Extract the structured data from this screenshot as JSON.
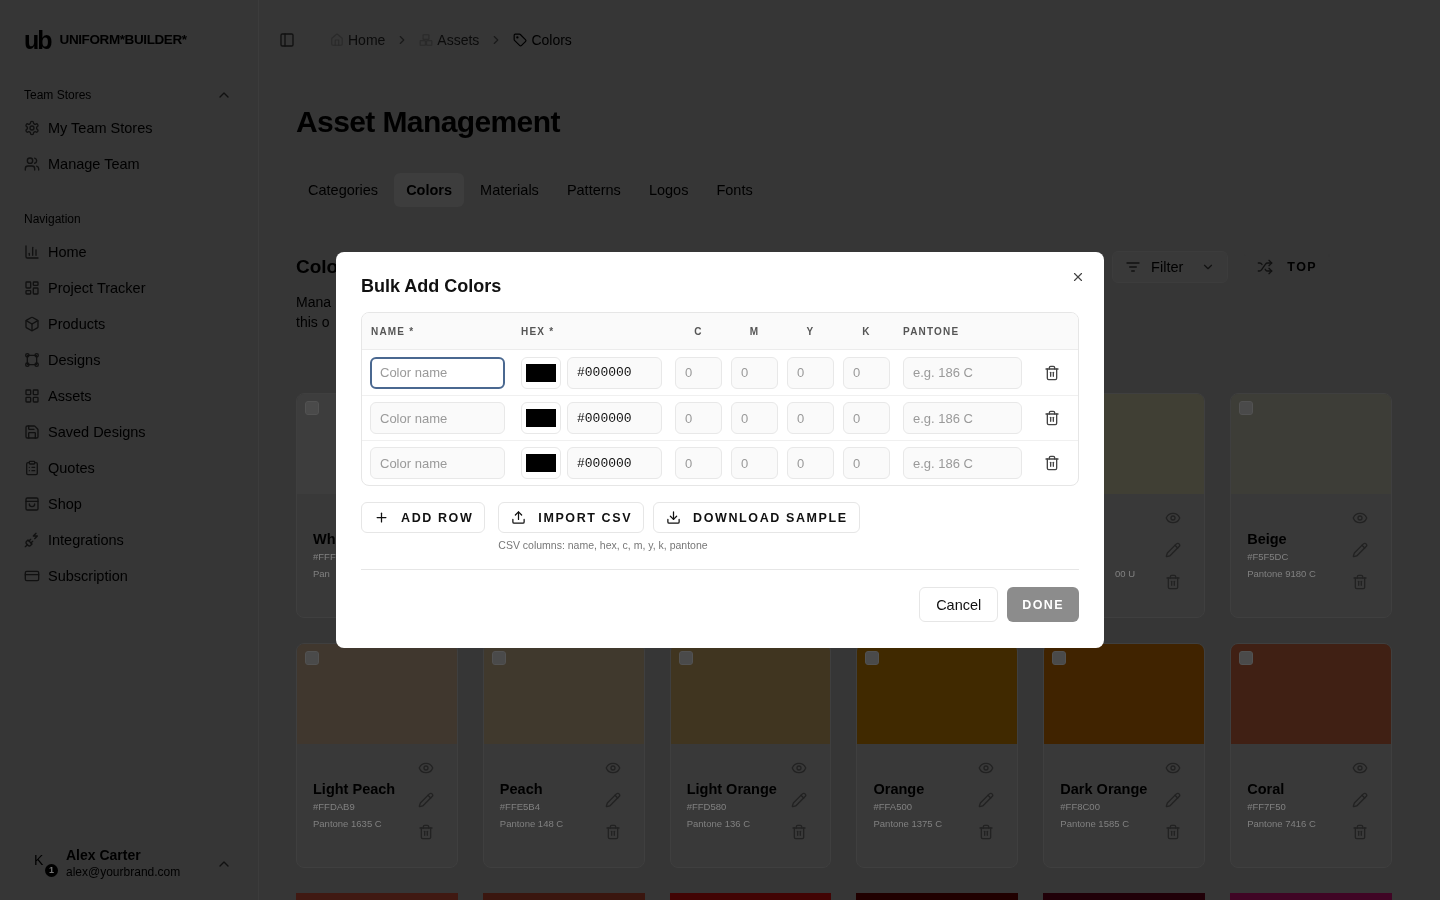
{
  "sidebar": {
    "logo": {
      "mark": "ub",
      "wordmark": "UNIFORM*BUILDER*"
    },
    "team_stores": {
      "title": "Team Stores",
      "expanded": true,
      "items": [
        {
          "label": "My Team Stores",
          "selected": false
        },
        {
          "label": "Manage Team",
          "selected": false
        }
      ]
    },
    "navigation": {
      "title": "Navigation",
      "items": [
        {
          "label": "Home",
          "selected": false
        },
        {
          "label": "Project Tracker",
          "selected": false
        },
        {
          "label": "Products",
          "selected": false
        },
        {
          "label": "Designs",
          "selected": false
        },
        {
          "label": "Assets",
          "selected": false
        },
        {
          "label": "Saved Designs",
          "selected": false
        },
        {
          "label": "Quotes",
          "selected": false
        },
        {
          "label": "Shop",
          "selected": false
        },
        {
          "label": "Integrations",
          "selected": false
        },
        {
          "label": "Subscription",
          "selected": false
        }
      ]
    },
    "user": {
      "initial": "K",
      "badge": "1",
      "name": "Alex Carter",
      "email": "alex@yourbrand.com"
    }
  },
  "header": {
    "breadcrumb": [
      {
        "label": "Home",
        "current": false
      },
      {
        "label": "Assets",
        "current": false
      },
      {
        "label": "Colors",
        "current": true
      }
    ]
  },
  "page": {
    "title": "Asset Management",
    "tabs": [
      {
        "label": "Categories",
        "selected": false
      },
      {
        "label": "Colors",
        "selected": true
      },
      {
        "label": "Materials",
        "selected": false
      },
      {
        "label": "Patterns",
        "selected": false
      },
      {
        "label": "Logos",
        "selected": false
      },
      {
        "label": "Fonts",
        "selected": false
      }
    ],
    "section": {
      "title": "Colo",
      "description": [
        "Mana",
        "this o"
      ]
    },
    "toolbar": {
      "filter": "Filter",
      "sort": "TOP"
    }
  },
  "cards": [
    [
      {
        "kind": "card",
        "name": "Wh",
        "hex": "#FFF",
        "pantone": "Pan",
        "color": "#3d3d3d",
        "checked": false
      },
      {
        "kind": "card",
        "pantone": "00 U",
        "color": "#403f34"
      },
      {
        "kind": "card",
        "name": "Beige",
        "hex": "#F5F5DC",
        "pantone": "Pantone 9180 C",
        "color": "#3d3d37",
        "checked": false
      }
    ],
    [
      {
        "kind": "card",
        "name": "Light Peach",
        "hex": "#FFDAB9",
        "pantone": "Pantone 1635 C",
        "color": "#40372e",
        "checked": false
      },
      {
        "kind": "card",
        "name": "Peach",
        "hex": "#FFE5B4",
        "pantone": "Pantone 148 C",
        "color": "#40392d",
        "checked": false
      },
      {
        "kind": "card",
        "name": "Light Orange",
        "hex": "#FFD580",
        "pantone": "Pantone 136 C",
        "color": "#403520",
        "checked": false
      },
      {
        "kind": "card",
        "name": "Orange",
        "hex": "#FFA500",
        "pantone": "Pantone 1375 C",
        "color": "#402900",
        "checked": false
      },
      {
        "kind": "card",
        "name": "Dark Orange",
        "hex": "#FF8C00",
        "pantone": "Pantone 1585 C",
        "color": "#402300",
        "checked": false
      },
      {
        "kind": "card",
        "name": "Coral",
        "hex": "#FF7F50",
        "pantone": "Pantone 7416 C",
        "color": "#402014",
        "checked": false
      }
    ],
    [
      {
        "kind": "swatch",
        "color": "#401912"
      },
      {
        "kind": "swatch",
        "color": "#3a160f"
      },
      {
        "kind": "swatch",
        "color": "#420404"
      },
      {
        "kind": "swatch",
        "color": "#200000"
      },
      {
        "kind": "swatch",
        "color": "#200008"
      },
      {
        "kind": "swatch",
        "color": "#400525"
      }
    ]
  ],
  "dialog": {
    "title": "Bulk Add Colors",
    "columns": [
      "NAME *",
      "HEX *",
      "C",
      "M",
      "Y",
      "K",
      "PANTONE"
    ],
    "rows": [
      {
        "name": {
          "placeholder": "Color name",
          "focused": true
        },
        "color": "#000000",
        "hex": {
          "value": "#000000"
        },
        "c": {
          "placeholder": "0"
        },
        "m": {
          "placeholder": "0"
        },
        "y": {
          "placeholder": "0"
        },
        "k": {
          "placeholder": "0"
        },
        "pantone": {
          "placeholder": "e.g. 186 C"
        }
      },
      {
        "name": {
          "placeholder": "Color name",
          "focused": false
        },
        "color": "#000000",
        "hex": {
          "value": "#000000"
        },
        "c": {
          "placeholder": "0"
        },
        "m": {
          "placeholder": "0"
        },
        "y": {
          "placeholder": "0"
        },
        "k": {
          "placeholder": "0"
        },
        "pantone": {
          "placeholder": "e.g. 186 C"
        }
      },
      {
        "name": {
          "placeholder": "Color name",
          "focused": false
        },
        "color": "#000000",
        "hex": {
          "value": "#000000"
        },
        "c": {
          "placeholder": "0"
        },
        "m": {
          "placeholder": "0"
        },
        "y": {
          "placeholder": "0"
        },
        "k": {
          "placeholder": "0"
        },
        "pantone": {
          "placeholder": "e.g. 186 C"
        }
      }
    ],
    "actions": [
      {
        "label": "ADD ROW"
      },
      {
        "label": "IMPORT CSV"
      },
      {
        "label": "DOWNLOAD SAMPLE"
      }
    ],
    "hint": "CSV columns: name, hex, c, m, y, k, pantone",
    "footer": {
      "cancel": "Cancel",
      "done": {
        "label": "DONE",
        "disabled": true
      }
    }
  }
}
